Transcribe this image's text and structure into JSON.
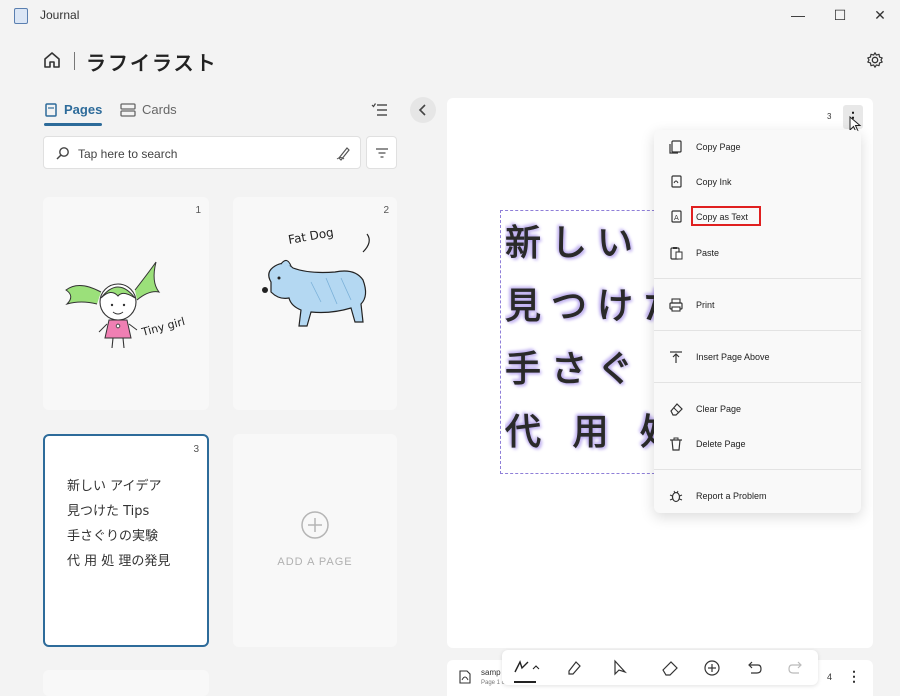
{
  "window": {
    "title": "Journal",
    "minimize": "—",
    "maximize": "☐",
    "close": "✕"
  },
  "header": {
    "notebook_title": "ラフイラスト"
  },
  "tabs": [
    {
      "label": "Pages"
    },
    {
      "label": "Cards"
    }
  ],
  "search": {
    "placeholder": "Tap here to search"
  },
  "pages": [
    {
      "num": "1",
      "caption": "Tiny girl"
    },
    {
      "num": "2",
      "caption": "Fat Dog"
    },
    {
      "num": "3",
      "lines": [
        "新しい アイデア",
        "見つけた Tips",
        "手さぐりの実験",
        "代 用 処 理の発見"
      ]
    }
  ],
  "add_page": {
    "label": "ADD A PAGE"
  },
  "canvas": {
    "page_number": "3",
    "handwriting": [
      "新しい ア",
      "見つけた",
      "手さぐ",
      "代 用 処"
    ]
  },
  "context_menu": {
    "items": [
      {
        "label": "Copy Page",
        "icon": "copy-page-icon"
      },
      {
        "label": "Copy Ink",
        "icon": "copy-ink-icon"
      },
      {
        "label": "Copy as Text",
        "icon": "copy-text-icon",
        "highlighted": true
      },
      {
        "label": "Paste",
        "icon": "paste-icon"
      },
      {
        "label": "Print",
        "icon": "print-icon"
      },
      {
        "label": "Insert Page Above",
        "icon": "insert-page-icon"
      },
      {
        "label": "Clear Page",
        "icon": "eraser-icon"
      },
      {
        "label": "Delete Page",
        "icon": "trash-icon"
      },
      {
        "label": "Report a Problem",
        "icon": "bug-icon"
      }
    ],
    "highlight_color": "#e02020"
  },
  "attachment": {
    "name": "samp",
    "pages": "Page 1 of 1",
    "page_count": "4"
  },
  "colors": {
    "accent": "#2d6b9a",
    "selection": "#8f7fd8"
  }
}
